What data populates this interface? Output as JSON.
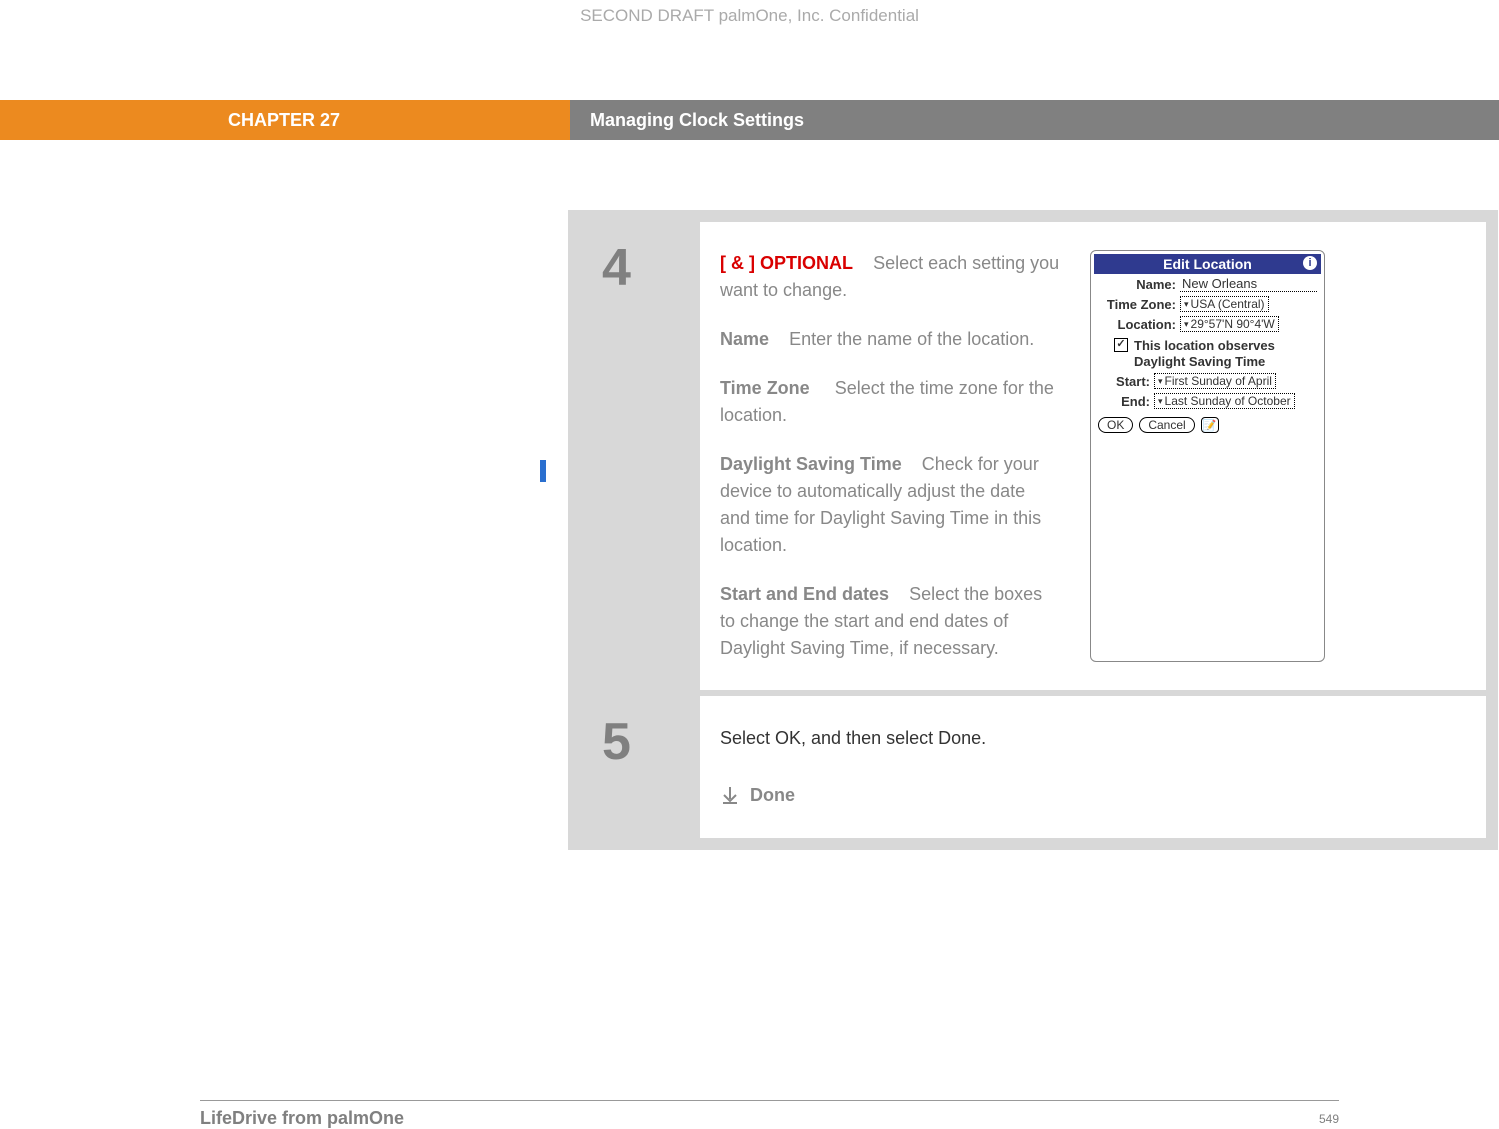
{
  "header": "SECOND DRAFT palmOne, Inc.  Confidential",
  "chapter": {
    "label": "CHAPTER 27",
    "title": "Managing Clock Settings"
  },
  "step4": {
    "num": "4",
    "opt_bracket": "[ & ]",
    "opt_word": "OPTIONAL",
    "intro_rest": "Select each setting you want to change.",
    "name_label": "Name",
    "name_text": "Enter the name of the location.",
    "tz_label": "Time Zone",
    "tz_text": "Select the time zone for the location.",
    "dst_label": "Daylight Saving Time",
    "dst_text": "Check for your device to automatically adjust the date and time for Daylight Saving Time in this location.",
    "dates_label": "Start and End dates",
    "dates_text": "Select the boxes to change the start and end dates of Daylight Saving Time, if necessary."
  },
  "step5": {
    "num": "5",
    "text": "Select OK, and then select Done.",
    "done": "Done"
  },
  "device": {
    "title": "Edit Location",
    "name_label": "Name:",
    "name_value": "New Orleans",
    "tz_label": "Time Zone:",
    "tz_value": "USA (Central)",
    "loc_label": "Location:",
    "loc_value": "29°57'N 90°4'W",
    "check_text": "This location observes Daylight Saving Time",
    "start_label": "Start:",
    "start_value": "First Sunday of April",
    "end_label": "End:",
    "end_value": "Last Sunday of October",
    "ok": "OK",
    "cancel": "Cancel"
  },
  "footer": {
    "product": "LifeDrive from palmOne",
    "page": "549"
  }
}
